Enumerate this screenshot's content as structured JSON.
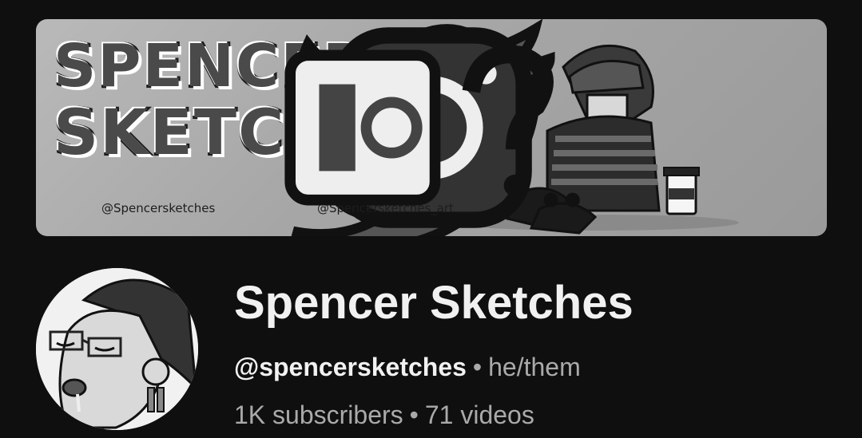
{
  "banner": {
    "title_line_1": "SPENCER",
    "title_line_2": "SKETCHES",
    "twitter_handle": "@Spencersketches",
    "instagram_handle": "@Spencersketches_art"
  },
  "channel": {
    "name": "Spencer Sketches",
    "handle": "@spencersketches",
    "separator": "•",
    "pronouns": "he/them",
    "subscribers": "1K subscribers",
    "videos": "71 videos"
  },
  "icons": {
    "banner_bird": "twitter-bird-icon",
    "banner_insta": "instagram-icon",
    "banner_corner": "sticker-question-icon"
  }
}
